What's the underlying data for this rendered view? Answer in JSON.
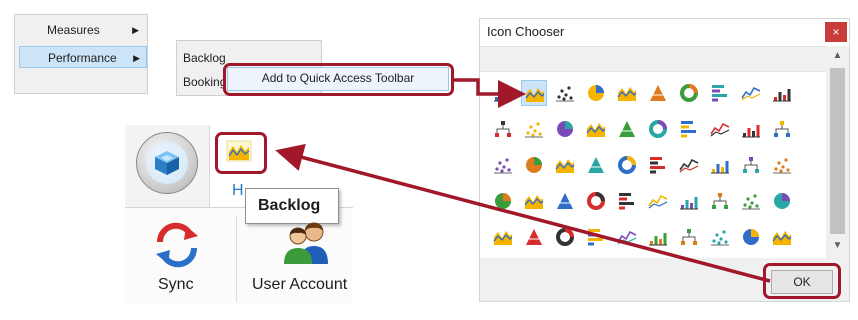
{
  "menu": {
    "items": [
      {
        "label": "Measures",
        "has_submenu": true
      },
      {
        "label": "Performance",
        "has_submenu": true,
        "highlighted": true
      }
    ],
    "submenu": [
      {
        "label": "Backlog"
      },
      {
        "label": "Booking"
      }
    ],
    "context_action": "Add to Quick Access Toolbar"
  },
  "ribbon": {
    "home_tab_partial": "H",
    "tooltip": "Backlog",
    "buttons": [
      {
        "label": "Sync",
        "icon": "sync-icon"
      },
      {
        "label": "User Account",
        "icon": "users-icon"
      }
    ]
  },
  "dialog": {
    "title": "Icon Chooser",
    "close_glyph": "×",
    "ok_label": "OK",
    "scroll_up": "▲",
    "scroll_down": "▼"
  },
  "colors": {
    "highlight_red": "#a0182a",
    "selection_blue": "#cce4f7"
  }
}
